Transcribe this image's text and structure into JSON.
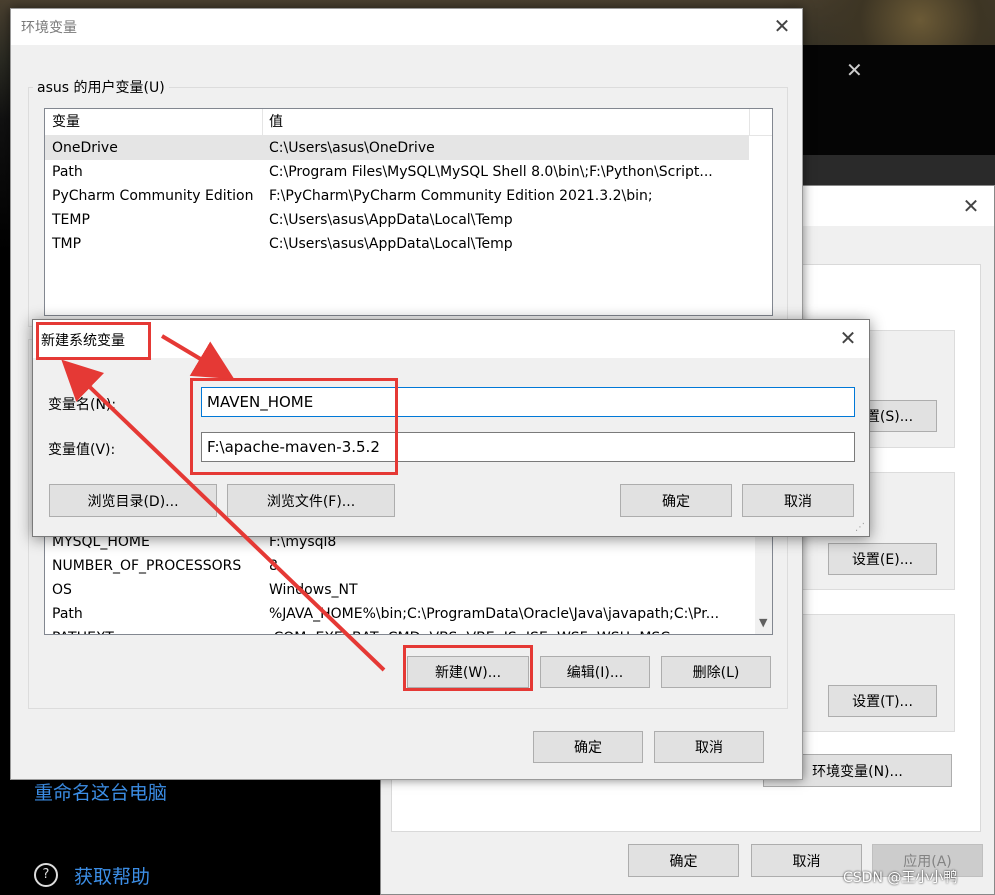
{
  "background": {
    "rename_pc_link": "重命名这台电脑",
    "get_help_link": "获取帮助",
    "watermark": "CSDN @王小小鸭"
  },
  "system_properties": {
    "env_vars_button": "环境变量(N)...",
    "settings_s_button": "设置(S)...",
    "settings_e_button": "设置(E)...",
    "settings_t_button": "设置(T)...",
    "ok_button": "确定",
    "cancel_button": "取消",
    "apply_button": "应用(A)"
  },
  "env_window": {
    "title": "环境变量",
    "user_group_label": "asus 的用户变量(U)",
    "columns": [
      "变量",
      "值"
    ],
    "user_vars": [
      {
        "name": "OneDrive",
        "value": "C:\\Users\\asus\\OneDrive"
      },
      {
        "name": "Path",
        "value": "C:\\Program Files\\MySQL\\MySQL Shell 8.0\\bin\\;F:\\Python\\Script..."
      },
      {
        "name": "PyCharm Community Edition",
        "value": "F:\\PyCharm\\PyCharm Community Edition 2021.3.2\\bin;"
      },
      {
        "name": "TEMP",
        "value": "C:\\Users\\asus\\AppData\\Local\\Temp"
      },
      {
        "name": "TMP",
        "value": "C:\\Users\\asus\\AppData\\Local\\Temp"
      }
    ],
    "system_vars": [
      {
        "name": "MYSQL_HOME",
        "value": "F:\\mysql8"
      },
      {
        "name": "NUMBER_OF_PROCESSORS",
        "value": "8"
      },
      {
        "name": "OS",
        "value": "Windows_NT"
      },
      {
        "name": "Path",
        "value": "%JAVA_HOME%\\bin;C:\\ProgramData\\Oracle\\Java\\javapath;C:\\Pr..."
      },
      {
        "name": "PATHEXT",
        "value": ".COM;.EXE;.BAT;.CMD;.VBS;.VBE;.JS;.JSE;.WSF;.WSH;.MSC"
      }
    ],
    "new_button": "新建(W)...",
    "edit_button": "编辑(I)...",
    "delete_button": "删除(L)",
    "ok_button": "确定",
    "cancel_button": "取消"
  },
  "new_var_dialog": {
    "title": "新建系统变量",
    "name_label": "变量名(N):",
    "value_label": "变量值(V):",
    "name_value": "MAVEN_HOME",
    "value_value": "F:\\apache-maven-3.5.2",
    "browse_dir_button": "浏览目录(D)...",
    "browse_file_button": "浏览文件(F)...",
    "ok_button": "确定",
    "cancel_button": "取消"
  },
  "colors": {
    "annotation_red": "#e53935",
    "focus_blue": "#0078d7",
    "link_blue": "#3c8ee6"
  }
}
